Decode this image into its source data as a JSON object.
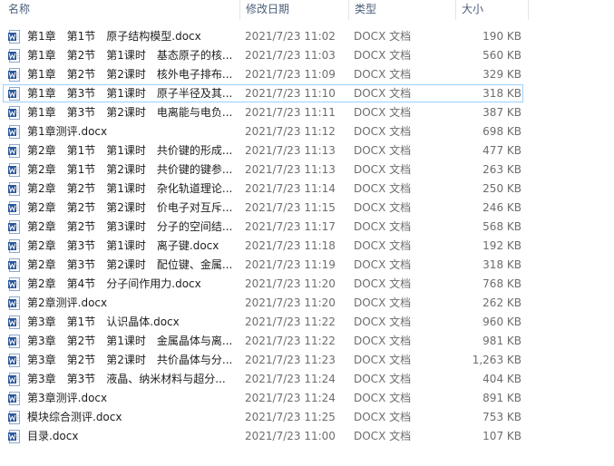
{
  "columns": {
    "name": "名称",
    "date": "修改日期",
    "type": "类型",
    "size": "大小"
  },
  "files": [
    {
      "name": "第1章　第1节　原子结构模型.docx",
      "date": "2021/7/23 11:02",
      "type": "DOCX 文档",
      "size": "190 KB"
    },
    {
      "name": "第1章　第2节　第1课时　基态原子的核...",
      "date": "2021/7/23 11:03",
      "type": "DOCX 文档",
      "size": "560 KB"
    },
    {
      "name": "第1章　第2节　第2课时　核外电子排布...",
      "date": "2021/7/23 11:09",
      "type": "DOCX 文档",
      "size": "329 KB"
    },
    {
      "name": "第1章　第3节　第1课时　原子半径及其...",
      "date": "2021/7/23 11:10",
      "type": "DOCX 文档",
      "size": "318 KB",
      "selected": true
    },
    {
      "name": "第1章　第3节　第2课时　电离能与电负...",
      "date": "2021/7/23 11:11",
      "type": "DOCX 文档",
      "size": "387 KB"
    },
    {
      "name": "第1章测评.docx",
      "date": "2021/7/23 11:12",
      "type": "DOCX 文档",
      "size": "698 KB"
    },
    {
      "name": "第2章　第1节　第1课时　共价键的形成...",
      "date": "2021/7/23 11:13",
      "type": "DOCX 文档",
      "size": "477 KB"
    },
    {
      "name": "第2章　第1节　第2课时　共价键的键参...",
      "date": "2021/7/23 11:13",
      "type": "DOCX 文档",
      "size": "263 KB"
    },
    {
      "name": "第2章　第2节　第1课时　杂化轨道理论...",
      "date": "2021/7/23 11:14",
      "type": "DOCX 文档",
      "size": "250 KB"
    },
    {
      "name": "第2章　第2节　第2课时　价电子对互斥...",
      "date": "2021/7/23 11:15",
      "type": "DOCX 文档",
      "size": "246 KB"
    },
    {
      "name": "第2章　第2节　第3课时　分子的空间结...",
      "date": "2021/7/23 11:17",
      "type": "DOCX 文档",
      "size": "568 KB"
    },
    {
      "name": "第2章　第3节　第1课时　离子键.docx",
      "date": "2021/7/23 11:18",
      "type": "DOCX 文档",
      "size": "192 KB"
    },
    {
      "name": "第2章　第3节　第2课时　配位键、金属...",
      "date": "2021/7/23 11:19",
      "type": "DOCX 文档",
      "size": "318 KB"
    },
    {
      "name": "第2章　第4节　分子间作用力.docx",
      "date": "2021/7/23 11:20",
      "type": "DOCX 文档",
      "size": "768 KB"
    },
    {
      "name": "第2章测评.docx",
      "date": "2021/7/23 11:20",
      "type": "DOCX 文档",
      "size": "262 KB"
    },
    {
      "name": "第3章　第1节　认识晶体.docx",
      "date": "2021/7/23 11:22",
      "type": "DOCX 文档",
      "size": "960 KB"
    },
    {
      "name": "第3章　第2节　第1课时　金属晶体与离...",
      "date": "2021/7/23 11:22",
      "type": "DOCX 文档",
      "size": "981 KB"
    },
    {
      "name": "第3章　第2节　第2课时　共价晶体与分...",
      "date": "2021/7/23 11:23",
      "type": "DOCX 文档",
      "size": "1,263 KB"
    },
    {
      "name": "第3章　第3节　液晶、纳米材料与超分...",
      "date": "2021/7/23 11:24",
      "type": "DOCX 文档",
      "size": "404 KB"
    },
    {
      "name": "第3章测评.docx",
      "date": "2021/7/23 11:24",
      "type": "DOCX 文档",
      "size": "891 KB"
    },
    {
      "name": "模块综合测评.docx",
      "date": "2021/7/23 11:25",
      "type": "DOCX 文档",
      "size": "753 KB"
    },
    {
      "name": "目录.docx",
      "date": "2021/7/23 11:00",
      "type": "DOCX 文档",
      "size": "107 KB"
    }
  ],
  "icon": "word-doc-icon",
  "colors": {
    "header_text": "#4c607a",
    "detail_text": "#6d6d6d",
    "selection_border": "#99d1ff",
    "word_blue": "#2b579a"
  }
}
